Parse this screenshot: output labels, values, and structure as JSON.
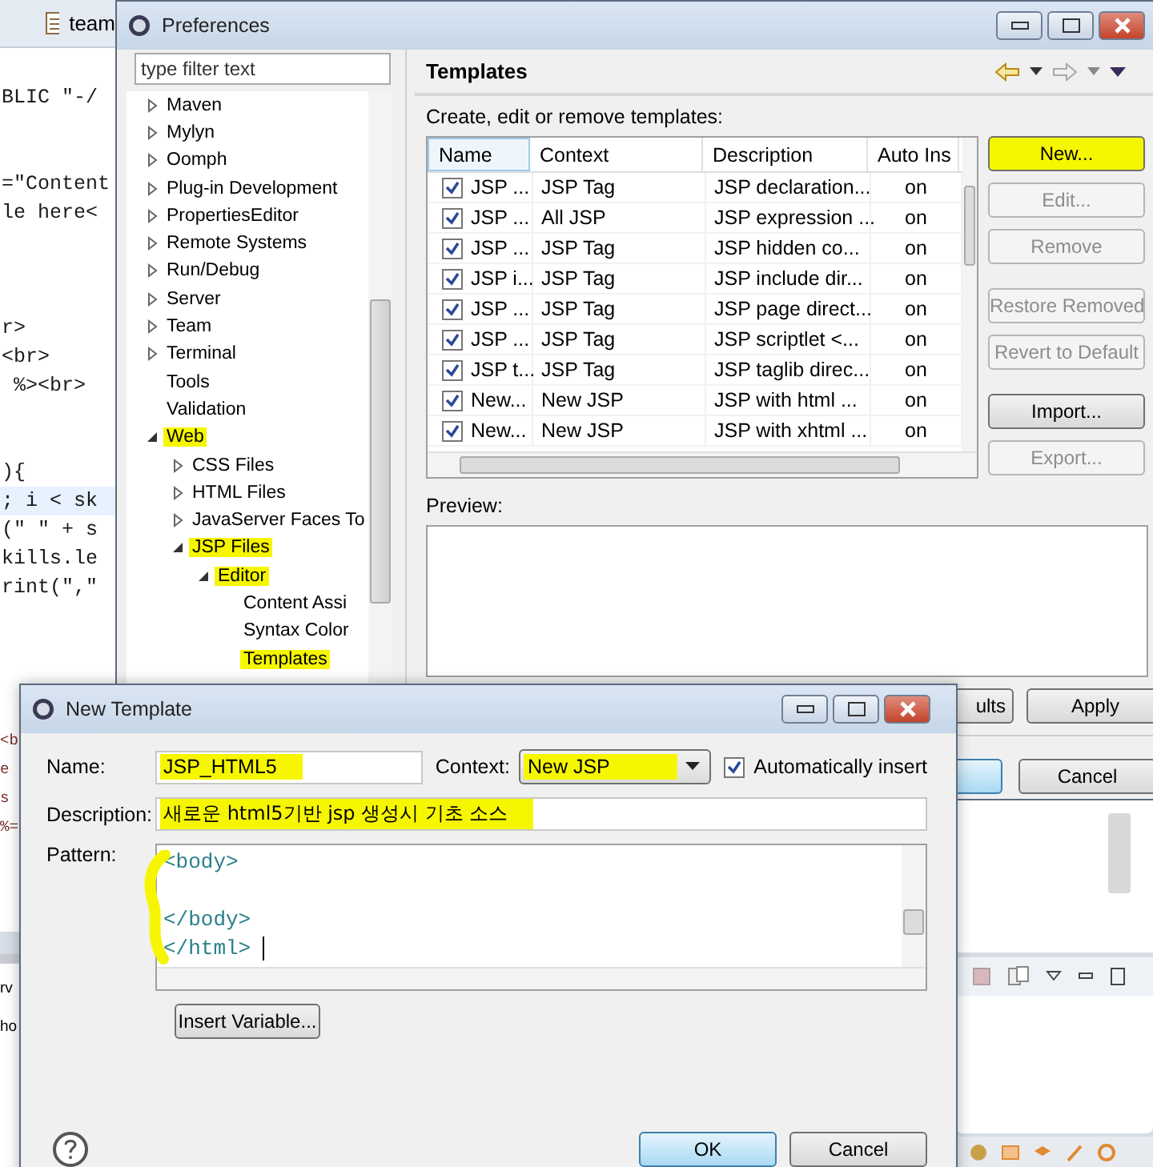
{
  "editor": {
    "tab": "team",
    "code": "BLIC \"-/\n\n\n=\"Content\nle here<\n\n\n\nr>\n<br>\n %><br>\n\n\n){\n; i < sk\n(\" \" + s\nkills.le\nrint(\",\"",
    "lower_code": "<b\ne\ns\n%=",
    "console_lines": "rv\nho"
  },
  "preferences": {
    "title": "Preferences",
    "filter_placeholder": "type filter text",
    "tree": [
      {
        "label": "Maven",
        "expanded": false,
        "highlighted": false
      },
      {
        "label": "Mylyn",
        "expanded": false,
        "highlighted": false
      },
      {
        "label": "Oomph",
        "expanded": false,
        "highlighted": false
      },
      {
        "label": "Plug-in Development",
        "expanded": false,
        "highlighted": false
      },
      {
        "label": "PropertiesEditor",
        "expanded": false,
        "highlighted": false
      },
      {
        "label": "Remote Systems",
        "expanded": false,
        "highlighted": false
      },
      {
        "label": "Run/Debug",
        "expanded": false,
        "highlighted": false
      },
      {
        "label": "Server",
        "expanded": false,
        "highlighted": false
      },
      {
        "label": "Team",
        "expanded": false,
        "highlighted": false
      },
      {
        "label": "Terminal",
        "expanded": false,
        "highlighted": false
      },
      {
        "label": "Tools",
        "highlighted": false
      },
      {
        "label": "Validation",
        "highlighted": false
      },
      {
        "label": "Web",
        "expanded": true,
        "highlighted": true,
        "children": [
          {
            "label": "CSS Files",
            "expanded": false,
            "highlighted": false
          },
          {
            "label": "HTML Files",
            "expanded": false,
            "highlighted": false
          },
          {
            "label": "JavaServer Faces To",
            "expanded": false,
            "highlighted": false
          },
          {
            "label": "JSP Files",
            "expanded": true,
            "highlighted": true,
            "children": [
              {
                "label": "Editor",
                "expanded": true,
                "highlighted": true,
                "children": [
                  {
                    "label": "Content Assi",
                    "highlighted": false
                  },
                  {
                    "label": "Syntax Color",
                    "highlighted": false
                  },
                  {
                    "label": "Templates",
                    "highlighted": true
                  }
                ]
              }
            ]
          }
        ]
      }
    ],
    "page_title": "Templates",
    "page_description": "Create, edit or remove templates:",
    "table": {
      "columns": [
        "Name",
        "Context",
        "Description",
        "Auto Ins"
      ],
      "rows": [
        {
          "enabled": true,
          "name": "JSP ...",
          "context": "JSP Tag",
          "description": "JSP declaration...",
          "auto_insert": "on"
        },
        {
          "enabled": true,
          "name": "JSP ...",
          "context": "All JSP",
          "description": "JSP expression ...",
          "auto_insert": "on"
        },
        {
          "enabled": true,
          "name": "JSP ...",
          "context": "JSP Tag",
          "description": "JSP hidden co...",
          "auto_insert": "on"
        },
        {
          "enabled": true,
          "name": "JSP i...",
          "context": "JSP Tag",
          "description": "JSP include dir...",
          "auto_insert": "on"
        },
        {
          "enabled": true,
          "name": "JSP ...",
          "context": "JSP Tag",
          "description": "JSP page direct...",
          "auto_insert": "on"
        },
        {
          "enabled": true,
          "name": "JSP ...",
          "context": "JSP Tag",
          "description": "JSP scriptlet <...",
          "auto_insert": "on"
        },
        {
          "enabled": true,
          "name": "JSP t...",
          "context": "JSP Tag",
          "description": "JSP taglib direc...",
          "auto_insert": "on"
        },
        {
          "enabled": true,
          "name": "New...",
          "context": "New JSP",
          "description": "JSP with html ...",
          "auto_insert": "on"
        },
        {
          "enabled": true,
          "name": "New...",
          "context": "New JSP",
          "description": "JSP with xhtml ...",
          "auto_insert": "on"
        }
      ]
    },
    "side_buttons": [
      {
        "label": "New...",
        "disabled": false,
        "highlighted": true
      },
      {
        "label": "Edit...",
        "disabled": true,
        "highlighted": false
      },
      {
        "label": "Remove",
        "disabled": true,
        "highlighted": false
      },
      {
        "label": "Restore Removed",
        "disabled": true,
        "highlighted": false
      },
      {
        "label": "Revert to Default",
        "disabled": true,
        "highlighted": false
      },
      {
        "label": "Import...",
        "disabled": false,
        "highlighted": false
      },
      {
        "label": "Export...",
        "disabled": true,
        "highlighted": false
      }
    ],
    "preview_label": "Preview:",
    "footer_buttons": [
      "ults",
      "Apply"
    ],
    "cancel_button": "Cancel"
  },
  "dialog": {
    "title": "New Template",
    "name": {
      "label": "Name:",
      "value": "JSP_HTML5",
      "highlighted": true
    },
    "context": {
      "label": "Context:",
      "value": "New JSP",
      "highlighted": true
    },
    "auto_insert": {
      "label": "Automatically insert",
      "checked": true
    },
    "description": {
      "label": "Description:",
      "value": "새로운 html5기반 jsp 생성시 기초 소스",
      "highlighted": true
    },
    "pattern": {
      "label": "Pattern:",
      "value": "<body>\n\n</body>\n</html> "
    },
    "insert_variable": "Insert Variable...",
    "buttons": [
      {
        "label": "OK",
        "default": true
      },
      {
        "label": "Cancel",
        "default": false
      }
    ]
  }
}
